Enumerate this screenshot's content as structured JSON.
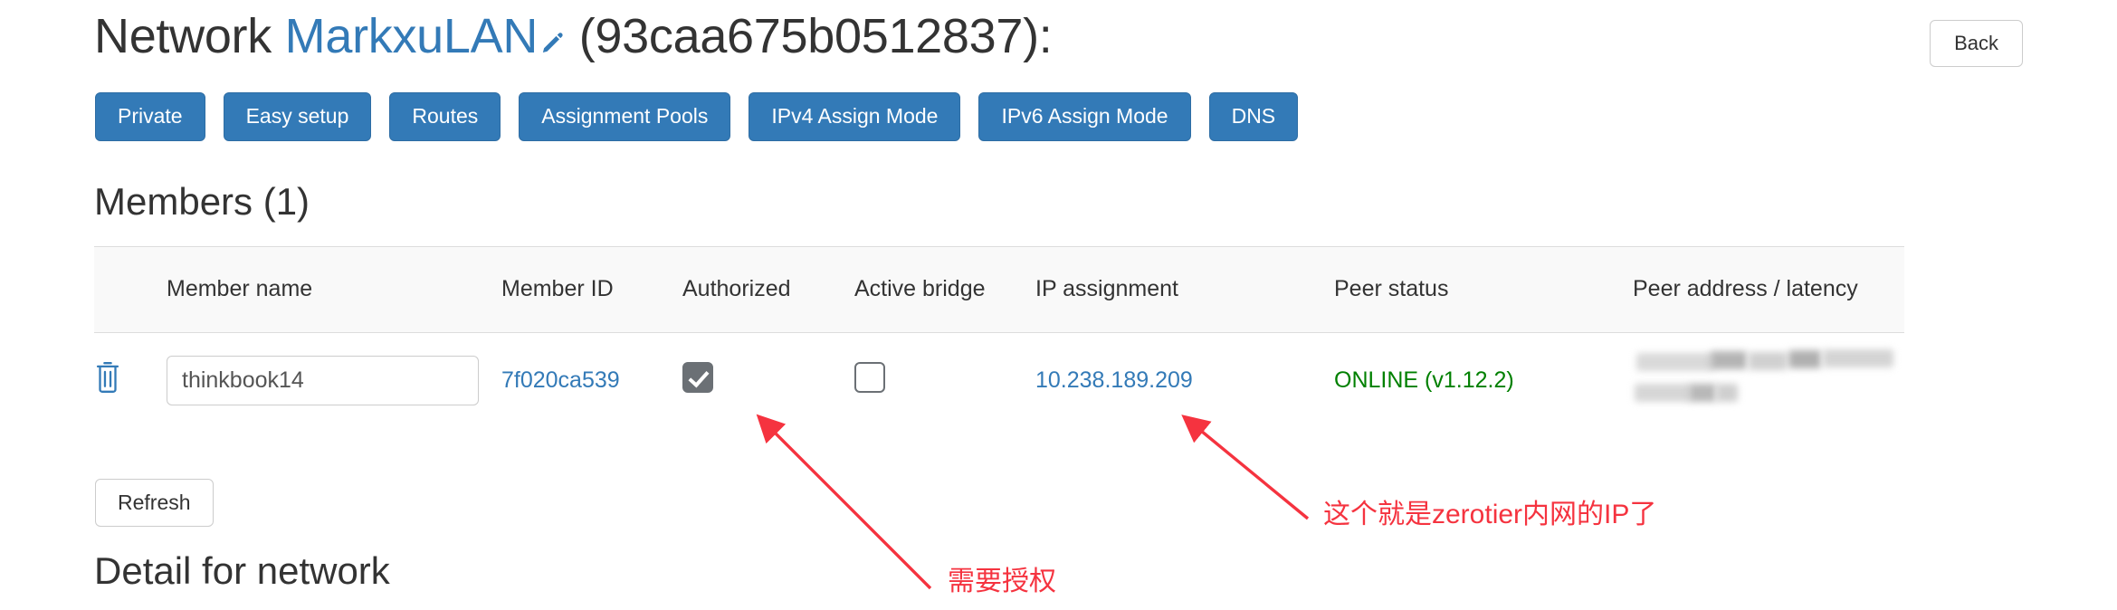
{
  "header": {
    "title_prefix": "Network ",
    "network_name": "MarkxuLAN",
    "edit_icon": "pencil-icon",
    "network_id_suffix": " (93caa675b0512837):",
    "back_label": "Back"
  },
  "nav_buttons": [
    {
      "label": "Private"
    },
    {
      "label": "Easy setup"
    },
    {
      "label": "Routes"
    },
    {
      "label": "Assignment Pools"
    },
    {
      "label": "IPv4 Assign Mode"
    },
    {
      "label": "IPv6 Assign Mode"
    },
    {
      "label": "DNS"
    }
  ],
  "members": {
    "heading": "Members (1)",
    "columns": [
      "",
      "Member name",
      "Member ID",
      "Authorized",
      "Active bridge",
      "IP assignment",
      "Peer status",
      "Peer address / latency"
    ],
    "rows": [
      {
        "delete_icon": "trash-icon",
        "member_name": "thinkbook14",
        "member_name_placeholder": "",
        "member_id": "7f020ca539",
        "authorized": true,
        "active_bridge": false,
        "ip_assignment": "10.238.189.209",
        "peer_status": "ONLINE (v1.12.2)",
        "peer_address": ""
      }
    ],
    "refresh_label": "Refresh"
  },
  "detail": {
    "heading": "Detail for network"
  },
  "annotations": [
    {
      "text": "需要授权"
    },
    {
      "text": "这个就是zerotier内网的IP了"
    }
  ],
  "colors": {
    "primary_blue": "#337ab7",
    "link_blue": "#337ab7",
    "online_green": "#008000",
    "annotation_red": "#f5333f",
    "table_header_bg": "#f9f9f9",
    "border_gray": "#dddddd"
  }
}
